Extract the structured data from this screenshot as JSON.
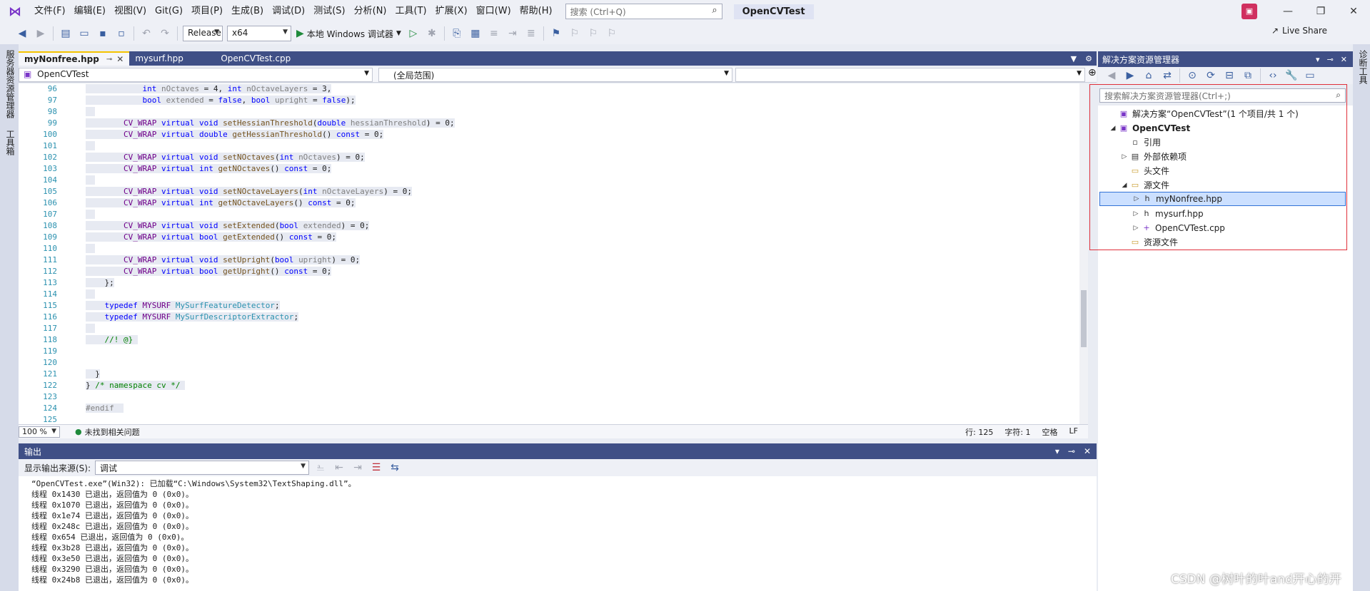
{
  "menu": {
    "items": [
      "文件(F)",
      "编辑(E)",
      "视图(V)",
      "Git(G)",
      "项目(P)",
      "生成(B)",
      "调试(D)",
      "测试(S)",
      "分析(N)",
      "工具(T)",
      "扩展(X)",
      "窗口(W)",
      "帮助(H)"
    ],
    "search_placeholder": "搜索 (Ctrl+Q)",
    "project_title": "OpenCVTest"
  },
  "toolbar": {
    "config": "Release",
    "platform": "x64",
    "run_label": "本地 Windows 调试器",
    "live_share": "Live Share"
  },
  "left_strip": {
    "server_explorer": "服务器资源管理器",
    "toolbox": "工具箱"
  },
  "right_strip": {
    "diagnostics": "诊断工具"
  },
  "editor": {
    "tabs": [
      {
        "label": "myNonfree.hpp",
        "active": true
      },
      {
        "label": "mysurf.hpp",
        "active": false
      },
      {
        "label": "OpenCVTest.cpp",
        "active": false
      }
    ],
    "nav_project": "OpenCVTest",
    "nav_scope": "(全局范围)",
    "nav_member": "",
    "line_numbers": [
      "96",
      "97",
      "98",
      "99",
      "100",
      "101",
      "102",
      "103",
      "104",
      "105",
      "106",
      "107",
      "108",
      "109",
      "110",
      "111",
      "112",
      "113",
      "114",
      "115",
      "116",
      "117",
      "118",
      "119",
      "120",
      "121",
      "122",
      "123",
      "124",
      "125"
    ],
    "zoom": "100 %",
    "issues": "未找到相关问题",
    "line": "行: 125",
    "char": "字符: 1",
    "whitespace": "空格",
    "eol": "LF"
  },
  "output": {
    "title": "输出",
    "source_label": "显示输出来源(S):",
    "source_value": "调试",
    "lines": [
      "“OpenCVTest.exe”(Win32): 已加载“C:\\Windows\\System32\\TextShaping.dll”。",
      "线程 0x1430 已退出，返回值为 0 (0x0)。",
      "线程 0x1070 已退出，返回值为 0 (0x0)。",
      "线程 0x1e74 已退出，返回值为 0 (0x0)。",
      "线程 0x248c 已退出，返回值为 0 (0x0)。",
      "线程 0x654 已退出，返回值为 0 (0x0)。",
      "线程 0x3b28 已退出，返回值为 0 (0x0)。",
      "线程 0x3e50 已退出，返回值为 0 (0x0)。",
      "线程 0x3290 已退出，返回值为 0 (0x0)。",
      "线程 0x24b8 已退出，返回值为 0 (0x0)。"
    ]
  },
  "solution_explorer": {
    "title": "解决方案资源管理器",
    "search_placeholder": "搜索解决方案资源管理器(Ctrl+;)",
    "items": [
      {
        "label": "解决方案“OpenCVTest”(1 个项目/共 1 个)",
        "icon": "solution-icon"
      },
      {
        "label": "OpenCVTest",
        "icon": "project-icon"
      },
      {
        "label": "引用",
        "icon": "references-icon"
      },
      {
        "label": "外部依赖项",
        "icon": "external-deps-icon"
      },
      {
        "label": "头文件",
        "icon": "folder-filter-icon"
      },
      {
        "label": "源文件",
        "icon": "folder-filter-icon"
      },
      {
        "label": "myNonfree.hpp",
        "icon": "header-file-icon"
      },
      {
        "label": "mysurf.hpp",
        "icon": "header-file-icon"
      },
      {
        "label": "OpenCVTest.cpp",
        "icon": "cpp-file-icon"
      },
      {
        "label": "资源文件",
        "icon": "folder-filter-icon"
      }
    ]
  },
  "watermark": "CSDN @树叶的叶and开心的开",
  "colors": {
    "accent": "#3f4f86",
    "highlight_box": "#e0303a",
    "selection": "#cce0ff"
  }
}
